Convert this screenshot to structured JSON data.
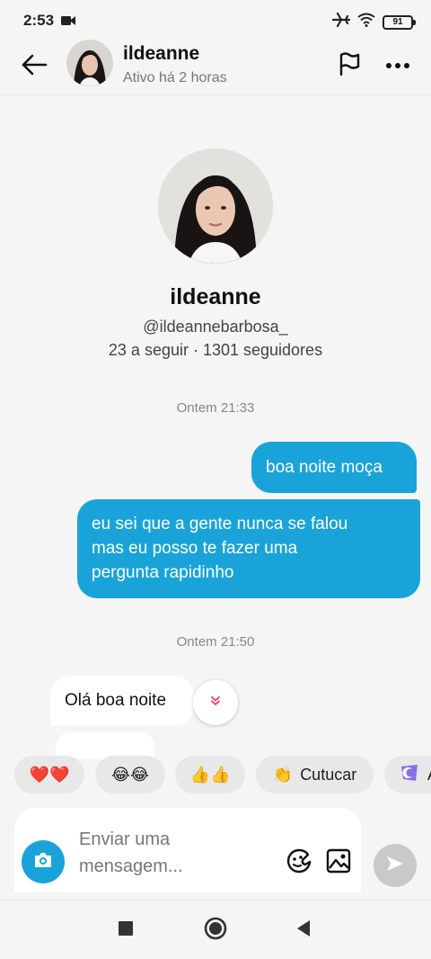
{
  "status_bar": {
    "time": "2:53",
    "battery": "91"
  },
  "header": {
    "name": "ildeanne",
    "status": "Ativo há 2 horas"
  },
  "profile": {
    "name": "ildeanne",
    "handle": "@ildeannebarbosa_",
    "stats": "23 a seguir · 1301 seguidores"
  },
  "messages": {
    "timestamp_1": "Ontem 21:33",
    "out_1": "boa noite moça",
    "out_2_line1": "eu sei que a gente nunca se falou",
    "out_2_line2": "mas eu posso te fazer uma",
    "out_2_line3": "pergunta rapidinho",
    "timestamp_2": "Ontem 21:50",
    "in_1": "Olá boa noite"
  },
  "quick_replies": {
    "hearts": "❤️❤️",
    "laughs": "😂😂",
    "thumbs": "👍👍",
    "poke_emoji": "👏",
    "poke_label": "Cutucar",
    "partial_label": "A"
  },
  "composer": {
    "placeholder_line1": "Enviar uma",
    "placeholder_line2": "mensagem..."
  },
  "colors": {
    "accent": "#1aa3d8",
    "background": "#f5f5f5"
  }
}
